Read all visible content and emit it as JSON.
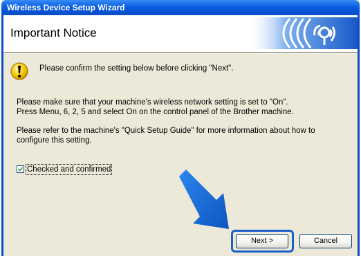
{
  "window": {
    "title": "Wireless Device Setup Wizard"
  },
  "header": {
    "title": "Important Notice",
    "logo_icon": "wireless-signal-icon"
  },
  "notice": {
    "icon": "warning-icon",
    "text": "Please confirm the setting below before clicking \"Next\"."
  },
  "body": {
    "paragraph1_line1": "Please make sure that your machine's wireless network setting is set to \"On\".",
    "paragraph1_line2": "Press Menu, 6, 2, 5 and select On on the control panel of the Brother machine.",
    "paragraph2_line1": "Please refer to the machine's \"Quick Setup Guide\" for more information about how to",
    "paragraph2_line2": "configure this setting."
  },
  "confirm_checkbox": {
    "label": "Checked and confirmed",
    "checked": true
  },
  "buttons": {
    "next_label": "Next >",
    "cancel_label": "Cancel"
  },
  "colors": {
    "titlebar": "#0a5fe0",
    "highlight": "#1a60c8",
    "arrow": "#1a6fd8"
  }
}
